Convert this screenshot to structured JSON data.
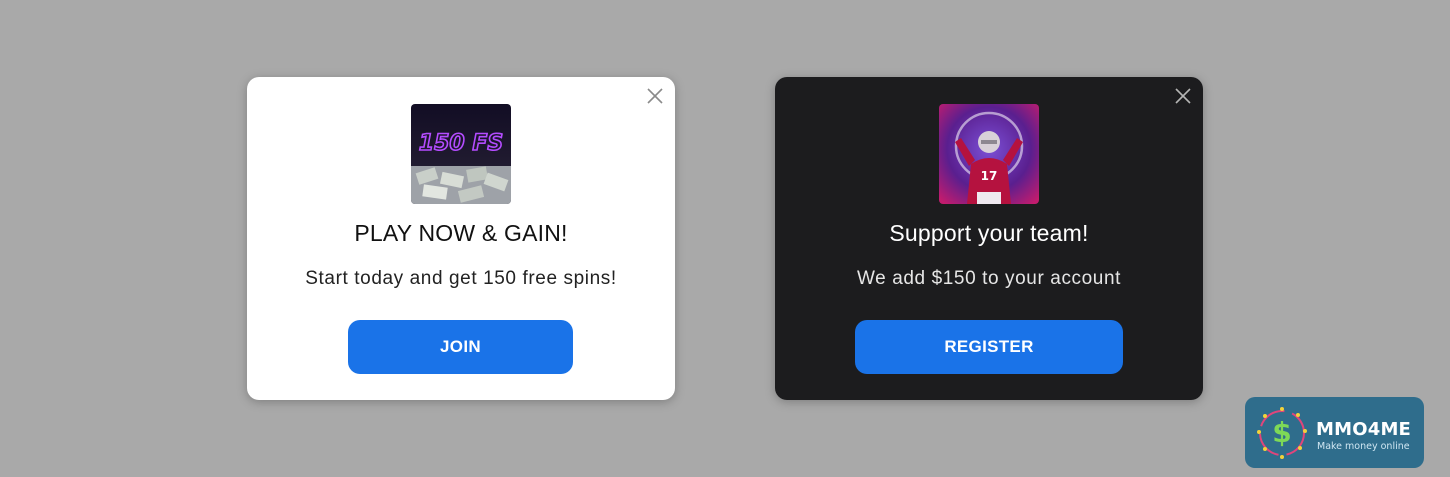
{
  "popups": [
    {
      "theme": "light",
      "image_text": "150 FS",
      "title": "PLAY NOW & GAIN!",
      "subtitle": "Start today and get 150 free spins!",
      "button_label": "JOIN",
      "close_icon": "close-icon"
    },
    {
      "theme": "dark",
      "image_text": "17",
      "title": "Support your team!",
      "subtitle": "We add $150 to your account",
      "button_label": "REGISTER",
      "close_icon": "close-icon"
    }
  ],
  "badge": {
    "name": "MMO4ME",
    "tagline": "Make money online",
    "logo_symbol": "$"
  },
  "colors": {
    "background": "#a9a9a9",
    "button": "#1a73e8",
    "dark_card": "#1c1c1e",
    "badge_bg": "#2f6d8c"
  }
}
